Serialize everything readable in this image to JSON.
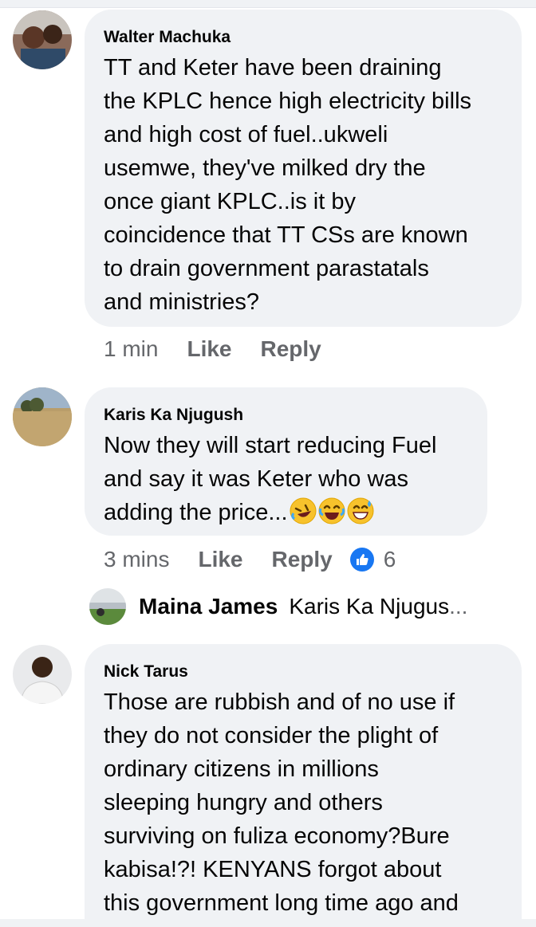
{
  "comments": [
    {
      "author": "Walter Machuka",
      "text": "TT and Keter have been draining\nthe KPLC hence high electricity bills\nand high cost of fuel..ukweli\nusemwe, they've milked dry the\nonce giant KPLC..is it by\ncoincidence that TT CSs are known\nto drain government parastatals\nand ministries?",
      "time": "1 min",
      "like_label": "Like",
      "reply_label": "Reply"
    },
    {
      "author": "Karis Ka Njugush",
      "text": "Now they will start reducing Fuel\nand say it was Keter who was\nadding the price...",
      "emojis": [
        "rolling-on-floor-laughing-emoji",
        "tears-of-joy-emoji",
        "grinning-sweat-emoji"
      ],
      "time": "3 mins",
      "like_label": "Like",
      "reply_label": "Reply",
      "reaction_icon": "like-reaction-icon",
      "reaction_count": "6",
      "reply_preview": {
        "author": "Maina James",
        "snippet": "Karis Ka Njugus",
        "ellipsis": "..."
      }
    },
    {
      "author": "Nick Tarus",
      "text": "Those are rubbish and of no use if\nthey do not consider the plight of\nordinary citizens in millions\nsleeping hungry and others\nsurviving on fuliza economy?Bure\nkabisa!?! KENYANS forgot about\nthis government long time ago and"
    }
  ],
  "colors": {
    "bubble": "#f0f2f5",
    "meta_text": "#65676b",
    "like_blue": "#1877f2"
  }
}
